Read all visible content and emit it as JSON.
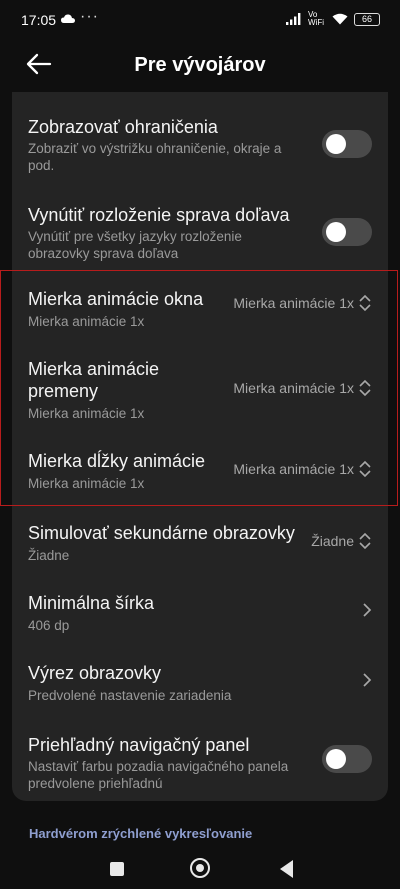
{
  "status_bar": {
    "time": "17:05",
    "dots": "···",
    "network": "Vo WiFi",
    "battery": "66"
  },
  "app_bar": {
    "title": "Pre vývojárov"
  },
  "settings": [
    {
      "title": "Zobrazovať ohraničenia",
      "subtitle_lines": [
        "Zobraziť vo výstrižku ohraničenie, okraje a",
        "pod."
      ],
      "control": "toggle",
      "enabled": false
    },
    {
      "title": "Vynútiť rozloženie sprava doľava",
      "subtitle_lines": [
        "Vynútiť pre všetky jazyky rozloženie",
        "obrazovky sprava doľava"
      ],
      "control": "toggle",
      "enabled": false
    },
    {
      "title": "Mierka animácie okna",
      "subtitle": "Mierka animácie 1x",
      "value": "Mierka animácie 1x",
      "control": "select"
    },
    {
      "title_lines": [
        "Mierka animácie",
        "premeny"
      ],
      "subtitle": "Mierka animácie 1x",
      "value": "Mierka animácie 1x",
      "control": "select"
    },
    {
      "title": "Mierka dĺžky animácie",
      "subtitle": "Mierka animácie 1x",
      "value": "Mierka animácie 1x",
      "control": "select"
    },
    {
      "title": "Simulovať sekundárne obrazovky",
      "subtitle": "Žiadne",
      "value": "Žiadne",
      "control": "select"
    },
    {
      "title": "Minimálna šírka",
      "subtitle": "406 dp",
      "control": "chevron"
    },
    {
      "title": "Výrez obrazovky",
      "subtitle": "Predvolené nastavenie zariadenia",
      "control": "chevron"
    },
    {
      "title": "Priehľadný navigačný panel",
      "subtitle_lines": [
        "Nastaviť farbu pozadia navigačného panela",
        "predvolene priehľadnú"
      ],
      "control": "toggle",
      "enabled": false
    }
  ],
  "section_header": "Hardvérom zrýchlené vykresľovanie",
  "colors": {
    "background": "#0f0f0f",
    "card": "#242424",
    "accent_header": "#8f9fd0",
    "highlight_box": "#b71c1c"
  }
}
